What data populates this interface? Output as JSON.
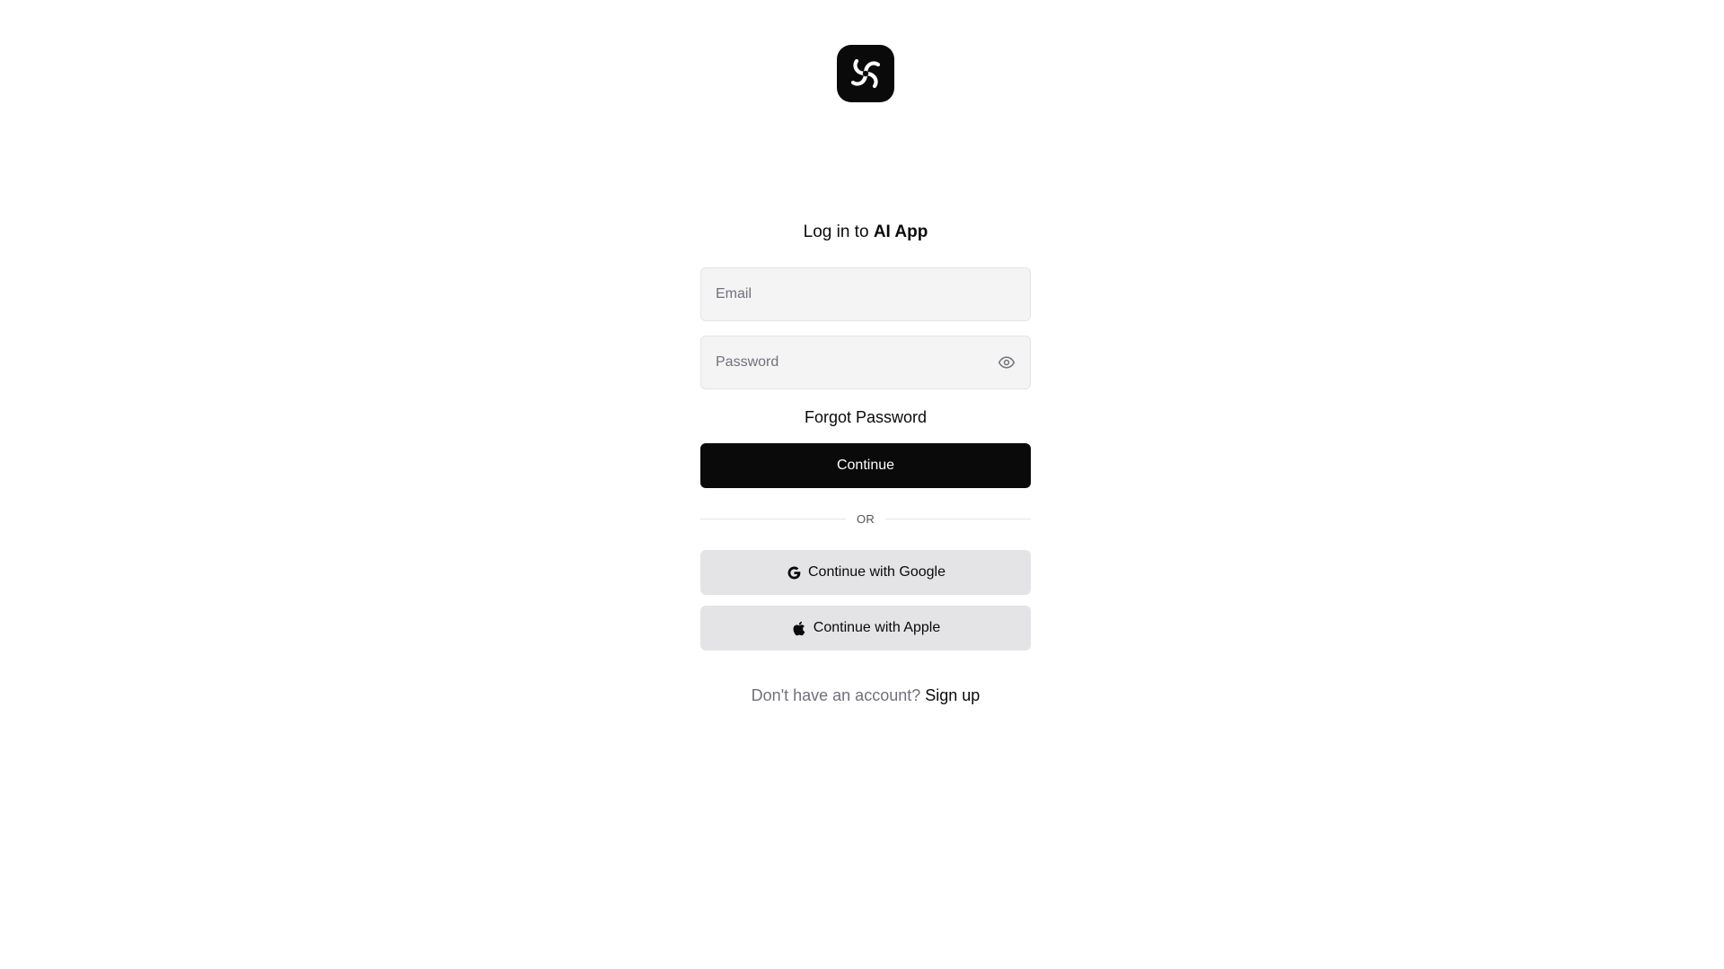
{
  "login": {
    "title_prefix": "Log in to",
    "title_brand": "AI App",
    "email_placeholder": "Email",
    "email_value": "",
    "password_placeholder": "Password",
    "password_value": "",
    "forgot_label": "Forgot Password",
    "continue_label": "Continue",
    "divider_label": "OR",
    "google_label": "Continue with Google",
    "apple_label": "Continue with Apple",
    "signup_prompt": "Don't have an account?",
    "signup_label": "Sign up"
  },
  "icons": {
    "logo": "swirl-logo-icon",
    "password_toggle": "eye-icon",
    "google": "google-icon",
    "apple": "apple-icon"
  },
  "colors": {
    "primary": "#0a0a0a",
    "input_bg": "#f4f4f5",
    "social_bg": "#e4e4e7",
    "muted_text": "#71717a"
  }
}
